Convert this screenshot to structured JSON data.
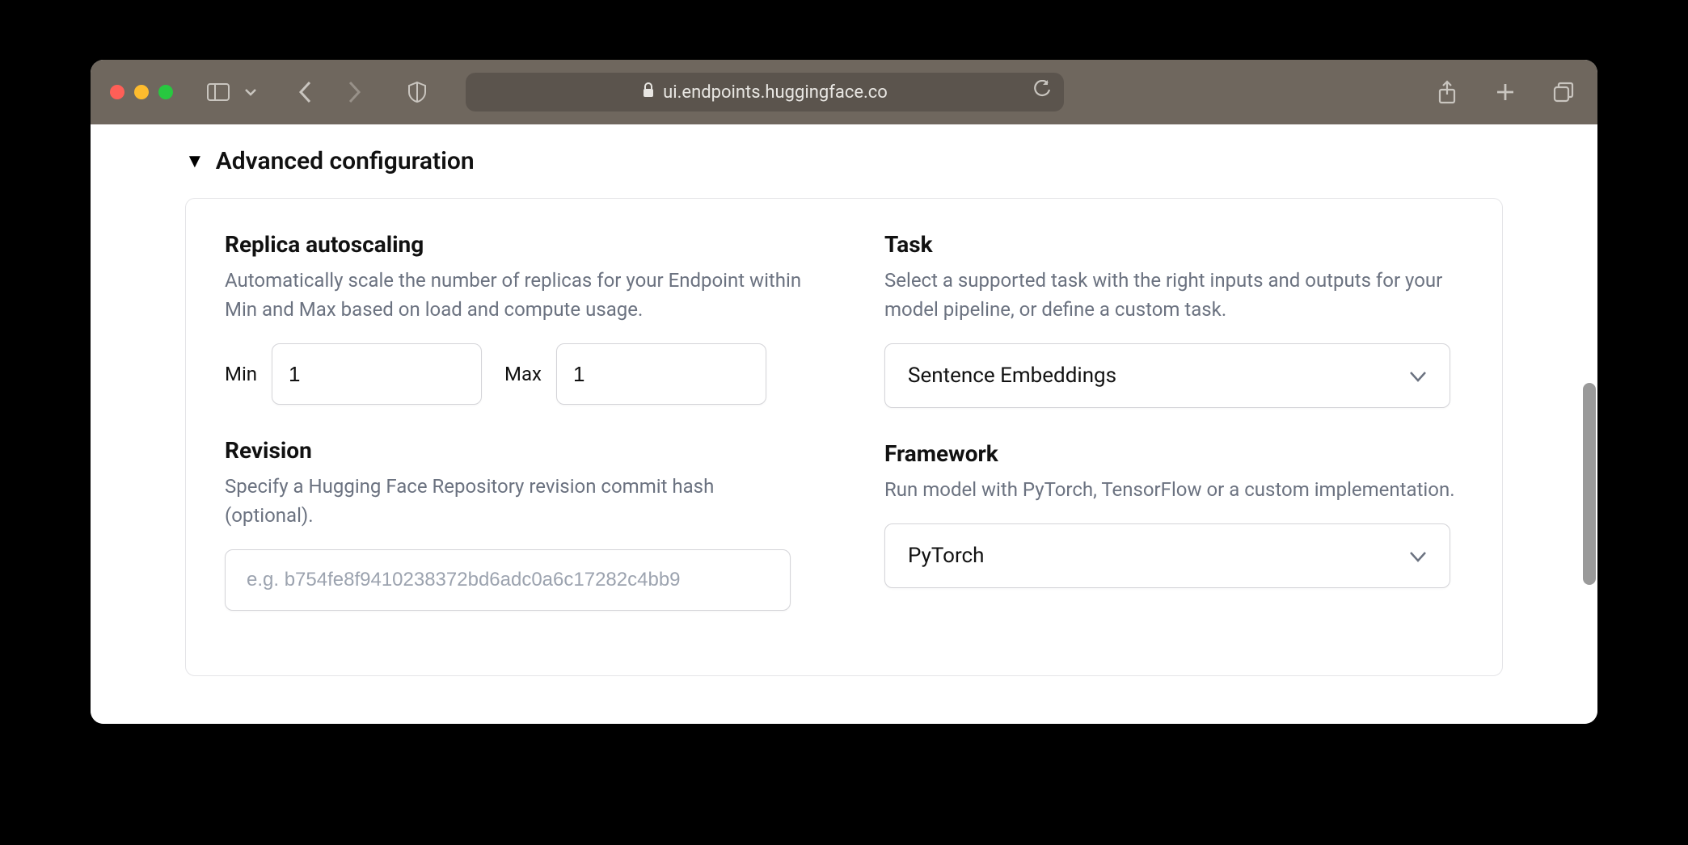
{
  "browser": {
    "url": "ui.endpoints.huggingface.co"
  },
  "page": {
    "disclosure_title": "Advanced configuration",
    "replica": {
      "title": "Replica autoscaling",
      "desc": "Automatically scale the number of replicas for your Endpoint within Min and Max based on load and compute usage.",
      "min_label": "Min",
      "min_value": "1",
      "max_label": "Max",
      "max_value": "1"
    },
    "revision": {
      "title": "Revision",
      "desc": "Specify a Hugging Face Repository revision commit hash (optional).",
      "placeholder": "e.g. b754fe8f9410238372bd6adc0a6c17282c4bb9"
    },
    "task": {
      "title": "Task",
      "desc": "Select a supported task with the right inputs and outputs for your model pipeline, or define a custom task.",
      "selected": "Sentence Embeddings"
    },
    "framework": {
      "title": "Framework",
      "desc": "Run model with PyTorch, TensorFlow or a custom implementation.",
      "selected": "PyTorch"
    }
  }
}
